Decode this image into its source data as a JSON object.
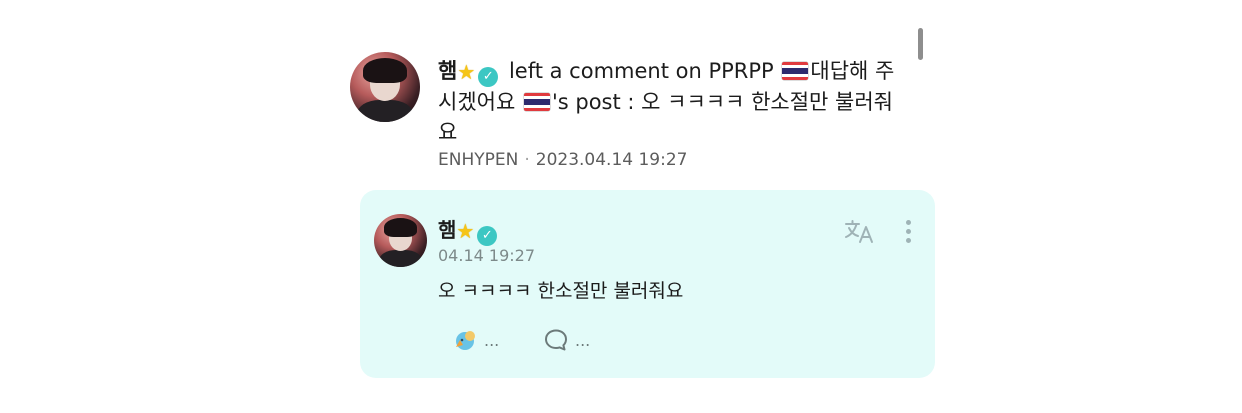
{
  "notification": {
    "nickname": "햄",
    "text_part1": " left a comment on PPRPP ",
    "text_part2": "대답해 주시겠어요 ",
    "text_part3": "'s post : 오 ㅋㅋㅋㅋ 한소절만 불러줘요",
    "group": "ENHYPEN",
    "separator": "·",
    "datetime": "2023.04.14 19:27"
  },
  "comment": {
    "nickname": "햄",
    "time": "04.14 19:27",
    "body": "오 ㅋㅋㅋㅋ 한소절만 불러줘요",
    "reaction_count": "...",
    "reply_count": "..."
  },
  "icons": {
    "star": "star-icon",
    "verified": "verified-icon",
    "flag": "thailand-flag-icon",
    "translate": "translate-icon",
    "more": "more-icon",
    "reaction": "reaction-icon",
    "reply": "comment-icon"
  },
  "colors": {
    "card_background": "#e3fbf9",
    "verified": "#3cc7c3",
    "star": "#f5c518"
  }
}
